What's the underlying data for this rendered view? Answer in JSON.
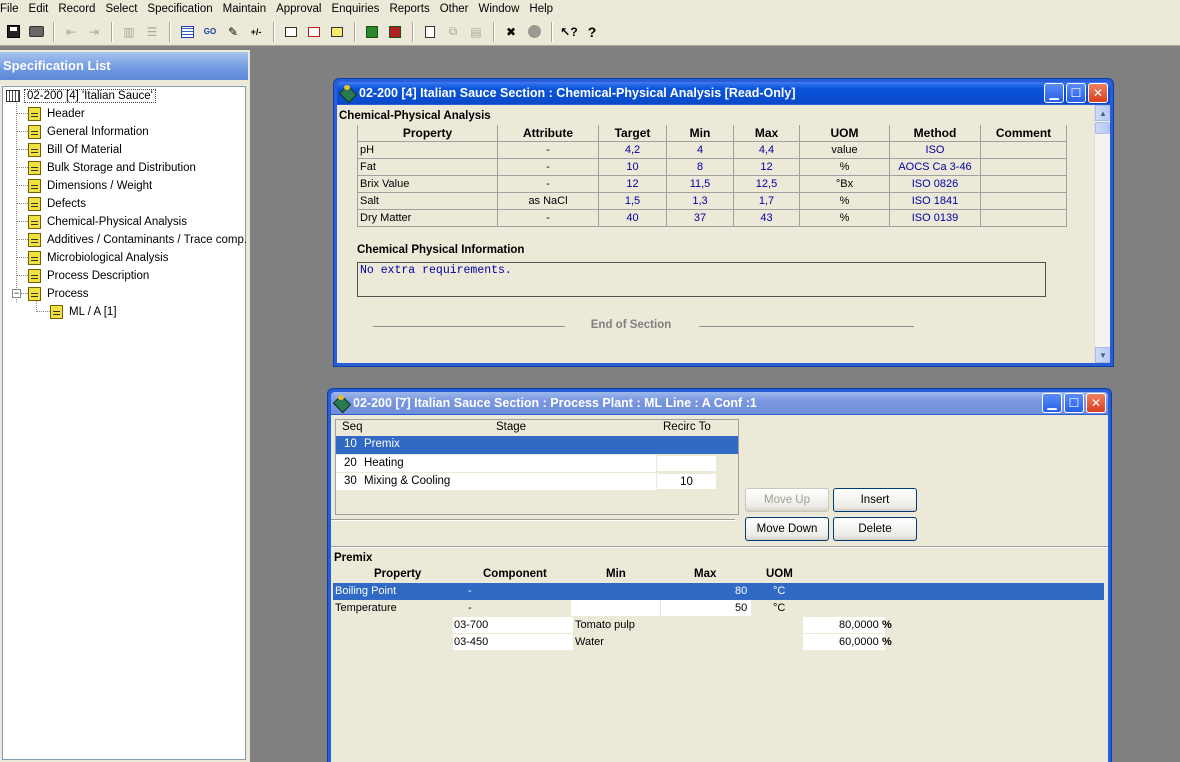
{
  "menu": [
    "File",
    "Edit",
    "Record",
    "Select",
    "Specification",
    "Maintain",
    "Approval",
    "Enquiries",
    "Reports",
    "Other",
    "Window",
    "Help"
  ],
  "toolbar": {
    "icons": [
      "save-icon",
      "print-icon",
      "outdent-icon",
      "indent-icon",
      "columns-icon",
      "rows-icon",
      "report-icon",
      "go-icon",
      "stamp-icon",
      "percent-icon",
      "window-icon",
      "copy-window-icon",
      "edit-window-icon",
      "export-icon",
      "import-icon",
      "document-icon",
      "copy-icon",
      "paste-icon",
      "clear-icon",
      "record-icon",
      "help-pointer-icon",
      "help-icon"
    ],
    "go_label": "GO",
    "percent_label": "+/-"
  },
  "spec_list": {
    "title": "Specification List",
    "root": "02-200 [4] 'Italian Sauce'",
    "items": [
      "Header",
      "General Information",
      "Bill Of Material",
      "Bulk Storage and Distribution",
      "Dimensions / Weight",
      "Defects",
      "Chemical-Physical Analysis",
      "Additives / Contaminants / Trace comp.",
      "Microbiological Analysis",
      "Process Description",
      "Process"
    ],
    "process_child": "ML / A [1]"
  },
  "chem_window": {
    "title": "02-200 [4] Italian Sauce  Section : Chemical-Physical Analysis  [Read-Only]",
    "section_title": "Chemical-Physical Analysis",
    "columns": [
      "Property",
      "Attribute",
      "Target",
      "Min",
      "Max",
      "UOM",
      "Method",
      "Comment"
    ],
    "rows": [
      [
        "pH",
        "-",
        "4,2",
        "4",
        "4,4",
        "value",
        "ISO",
        ""
      ],
      [
        "Fat",
        "-",
        "10",
        "8",
        "12",
        "%",
        "AOCS Ca 3-46",
        ""
      ],
      [
        "Brix Value",
        "-",
        "12",
        "11,5",
        "12,5",
        "°Bx",
        "ISO 0826",
        ""
      ],
      [
        "Salt",
        "as NaCl",
        "1,5",
        "1,3",
        "1,7",
        "%",
        "ISO 1841",
        ""
      ],
      [
        "Dry Matter",
        "-",
        "40",
        "37",
        "43",
        "%",
        "ISO 0139",
        ""
      ]
    ],
    "info_title": "Chemical Physical Information",
    "info_text": "No extra requirements.",
    "end_of_section": "End of Section"
  },
  "process_window": {
    "title": "02-200 [7] Italian Sauce  Section : Process  Plant : ML  Line : A Conf :1",
    "stage_headers": [
      "Seq",
      "Stage",
      "Recirc To"
    ],
    "stages": [
      {
        "seq": "10",
        "stage": "Premix",
        "recirc": ""
      },
      {
        "seq": "20",
        "stage": "Heating",
        "recirc": ""
      },
      {
        "seq": "30",
        "stage": "Mixing & Cooling",
        "recirc": "10"
      }
    ],
    "buttons": {
      "move_up": "Move Up",
      "insert": "Insert",
      "move_down": "Move Down",
      "delete": "Delete"
    },
    "premix_title": "Premix",
    "premix_headers": [
      "Property",
      "Component",
      "Min",
      "Max",
      "UOM"
    ],
    "premix_rows": [
      {
        "property": "Boiling Point",
        "component": "-",
        "min": "",
        "max": "80",
        "uom": "°C"
      },
      {
        "property": "Temperature",
        "component": "-",
        "min": "",
        "max": "50",
        "uom": "°C"
      }
    ],
    "components": [
      {
        "code": "03-700",
        "name": "Tomato pulp",
        "pct": "80,0000",
        "unit": "%"
      },
      {
        "code": "03-450",
        "name": "Water",
        "pct": "60,0000",
        "unit": "%"
      }
    ]
  }
}
